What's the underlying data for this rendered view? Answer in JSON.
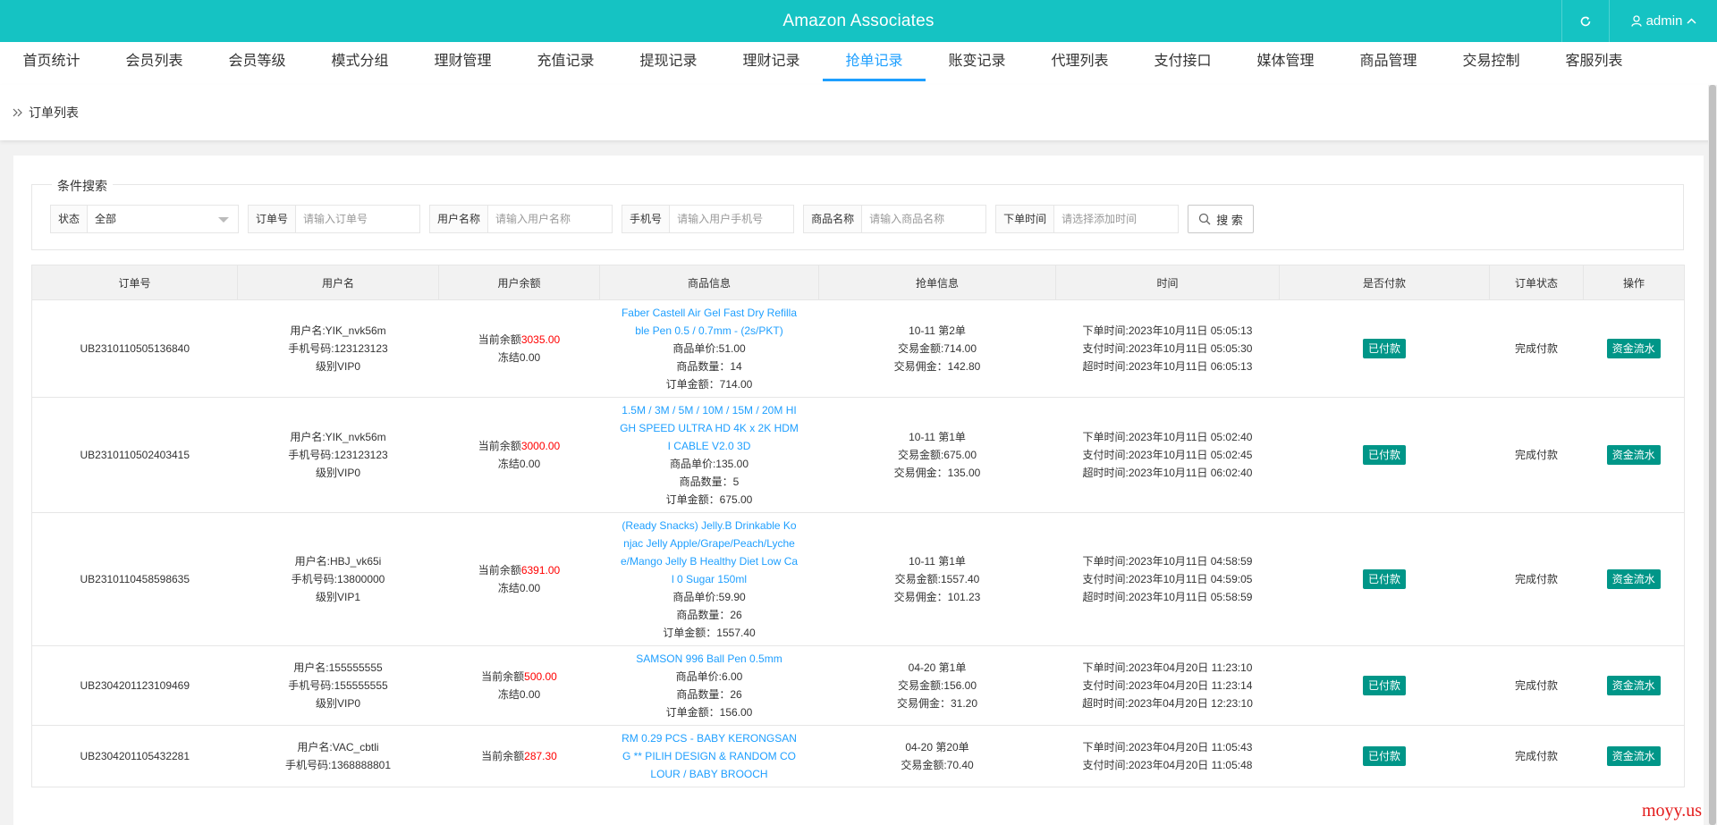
{
  "header": {
    "title": "Amazon Associates",
    "user": "admin",
    "refresh_icon": "refresh-icon",
    "user_icon": "user-icon"
  },
  "nav": {
    "tabs": [
      {
        "label": "首页统计"
      },
      {
        "label": "会员列表"
      },
      {
        "label": "会员等级"
      },
      {
        "label": "模式分组"
      },
      {
        "label": "理财管理"
      },
      {
        "label": "充值记录"
      },
      {
        "label": "提现记录"
      },
      {
        "label": "理财记录"
      },
      {
        "label": "抢单记录"
      },
      {
        "label": "账变记录"
      },
      {
        "label": "代理列表"
      },
      {
        "label": "支付接口"
      },
      {
        "label": "媒体管理"
      },
      {
        "label": "商品管理"
      },
      {
        "label": "交易控制"
      },
      {
        "label": "客服列表"
      }
    ],
    "active": "抢单记录"
  },
  "breadcrumb": {
    "label": "订单列表"
  },
  "search": {
    "legend": "条件搜索",
    "status_label": "状态",
    "status_value": "全部",
    "order_label": "订单号",
    "order_placeholder": "请输入订单号",
    "user_label": "用户名称",
    "user_placeholder": "请输入用户名称",
    "phone_label": "手机号",
    "phone_placeholder": "请输入用户手机号",
    "goods_label": "商品名称",
    "goods_placeholder": "请输入商品名称",
    "time_label": "下单时间",
    "time_placeholder": "请选择添加时间",
    "button": "搜 索"
  },
  "table": {
    "headers": [
      "订单号",
      "用户名",
      "用户余额",
      "商品信息",
      "抢单信息",
      "时间",
      "是否付款",
      "订单状态",
      "操作"
    ],
    "rows": [
      {
        "order_no": "UB2310110505136840",
        "user": [
          "用户名:YIK_nvk56m",
          "手机号码:123123123",
          "级别VIP0"
        ],
        "balance_prefix": "当前余额",
        "balance": "3035.00",
        "frozen": "冻结0.00",
        "goods_title": "Faber Castell Air Gel Fast Dry Refillable Pen 0.5 / 0.7mm - (2s/PKT)",
        "goods_price": "商品单价:51.00",
        "goods_qty": "商品数量：14",
        "goods_total": "订单金额：714.00",
        "grab": [
          "10-11 第2单",
          "交易金额:714.00",
          "交易佣金：142.80"
        ],
        "time": [
          "下单时间:2023年10月11日 05:05:13",
          "支付时间:2023年10月11日 05:05:30",
          "超时时间:2023年10月11日 06:05:13"
        ],
        "paid": "已付款",
        "status": "完成付款",
        "action": "资金流水"
      },
      {
        "order_no": "UB2310110502403415",
        "user": [
          "用户名:YIK_nvk56m",
          "手机号码:123123123",
          "级别VIP0"
        ],
        "balance_prefix": "当前余额",
        "balance": "3000.00",
        "frozen": "冻结0.00",
        "goods_title": "1.5M / 3M / 5M / 10M / 15M / 20M HIGH SPEED ULTRA HD 4K x 2K HDMI CABLE V2.0 3D",
        "goods_price": "商品单价:135.00",
        "goods_qty": "商品数量：5",
        "goods_total": "订单金额：675.00",
        "grab": [
          "10-11 第1单",
          "交易金额:675.00",
          "交易佣金：135.00"
        ],
        "time": [
          "下单时间:2023年10月11日 05:02:40",
          "支付时间:2023年10月11日 05:02:45",
          "超时时间:2023年10月11日 06:02:40"
        ],
        "paid": "已付款",
        "status": "完成付款",
        "action": "资金流水"
      },
      {
        "order_no": "UB2310110458598635",
        "user": [
          "用户名:HBJ_vk65i",
          "手机号码:13800000",
          "级别VIP1"
        ],
        "balance_prefix": "当前余额",
        "balance": "6391.00",
        "frozen": "冻结0.00",
        "goods_title": "(Ready Snacks) Jelly.B Drinkable Konjac Jelly Apple/Grape/Peach/Lychee/Mango Jelly B Healthy Diet Low Cal 0 Sugar 150ml",
        "goods_price": "商品单价:59.90",
        "goods_qty": "商品数量：26",
        "goods_total": "订单金额：1557.40",
        "grab": [
          "10-11 第1单",
          "交易金额:1557.40",
          "交易佣金：101.23"
        ],
        "time": [
          "下单时间:2023年10月11日 04:58:59",
          "支付时间:2023年10月11日 04:59:05",
          "超时时间:2023年10月11日 05:58:59"
        ],
        "paid": "已付款",
        "status": "完成付款",
        "action": "资金流水"
      },
      {
        "order_no": "UB2304201123109469",
        "user": [
          "用户名:155555555",
          "手机号码:155555555",
          "级别VIP0"
        ],
        "balance_prefix": "当前余额",
        "balance": "500.00",
        "frozen": "冻结0.00",
        "goods_title": "SAMSON 996 Ball Pen 0.5mm",
        "goods_price": "商品单价:6.00",
        "goods_qty": "商品数量：26",
        "goods_total": "订单金额：156.00",
        "grab": [
          "04-20 第1单",
          "交易金额:156.00",
          "交易佣金：31.20"
        ],
        "time": [
          "下单时间:2023年04月20日 11:23:10",
          "支付时间:2023年04月20日 11:23:14",
          "超时时间:2023年04月20日 12:23:10"
        ],
        "paid": "已付款",
        "status": "完成付款",
        "action": "资金流水"
      },
      {
        "order_no": "UB2304201105432281",
        "user": [
          "用户名:VAC_cbtli",
          "手机号码:1368888801",
          ""
        ],
        "balance_prefix": "当前余额",
        "balance": "287.30",
        "frozen": "",
        "goods_title": "RM 0.29 PCS - BABY KERONGSANG ** PILIH DESIGN & RANDOM COLOUR / BABY BROOCH",
        "goods_price": "",
        "goods_qty": "",
        "goods_total": "",
        "grab": [
          "04-20 第20单",
          "交易金额:70.40",
          ""
        ],
        "time": [
          "下单时间:2023年04月20日 11:05:43",
          "支付时间:2023年04月20日 11:05:48",
          ""
        ],
        "paid": "已付款",
        "status": "完成付款",
        "action": "资金流水"
      }
    ]
  },
  "watermark": "moyy.us",
  "colors": {
    "topbar": "#15c3c3",
    "active_tab": "#1e9fff",
    "badge": "#009688",
    "balance": "#ff0000"
  }
}
